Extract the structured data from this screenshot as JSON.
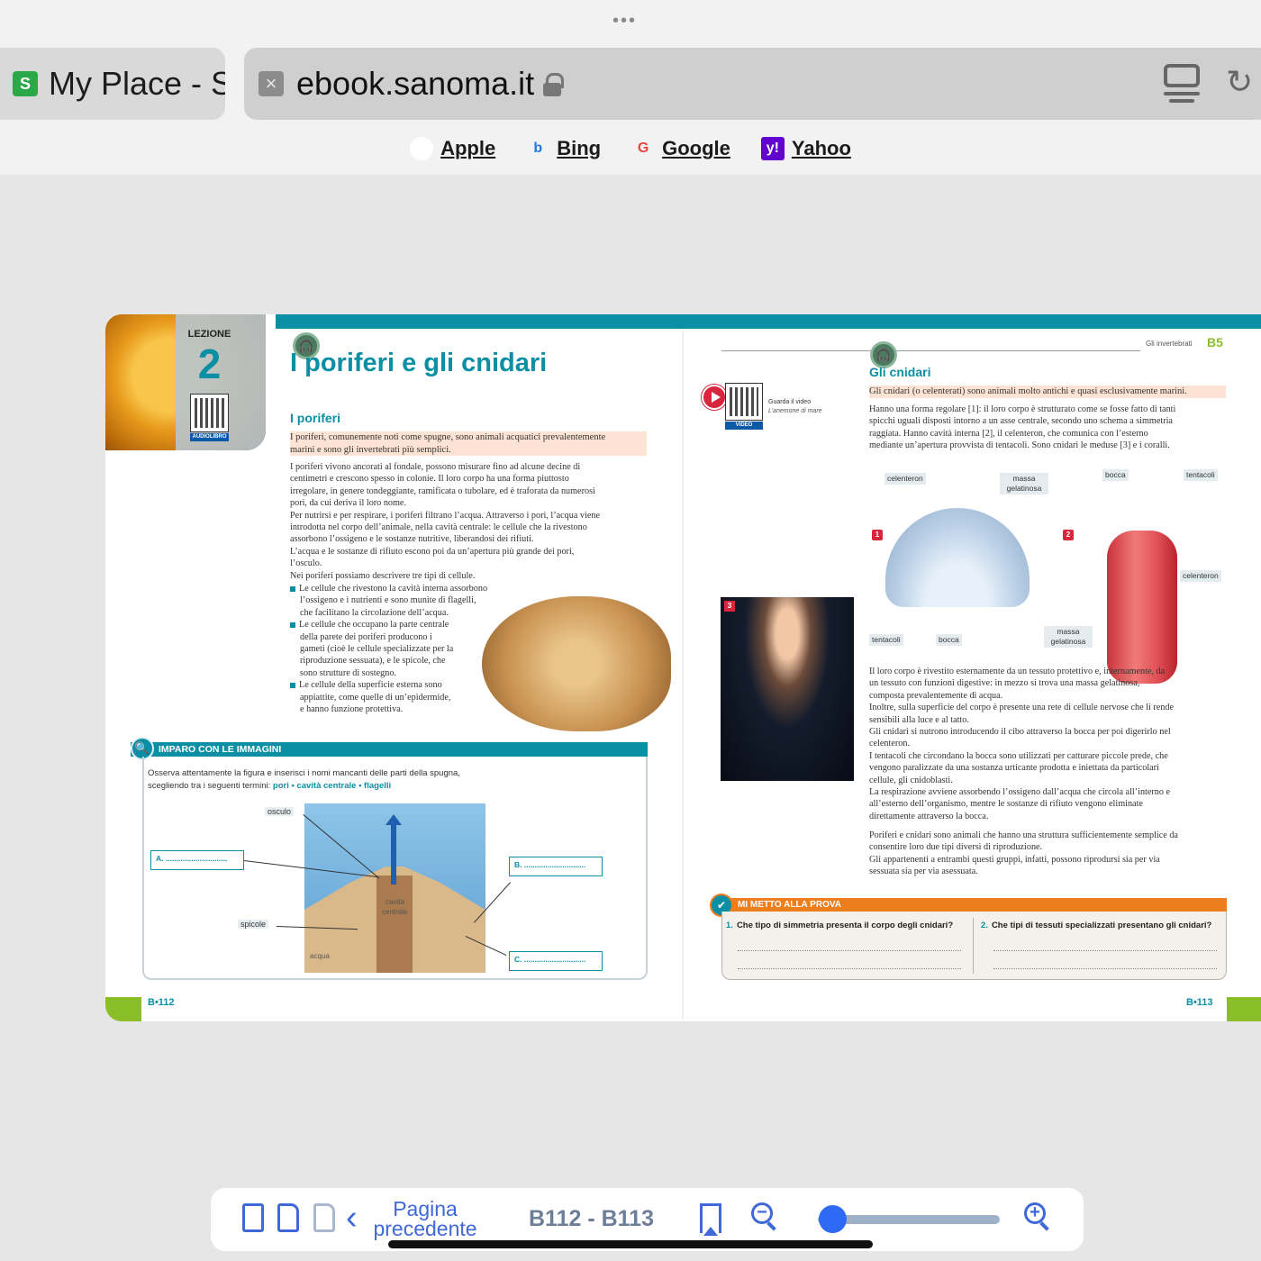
{
  "browser": {
    "more_dots": "•••",
    "tab": {
      "favicon": "S",
      "title": "My Place - S"
    },
    "url": "ebook.sanoma.it",
    "reader_icon": "reader-mode-icon",
    "reload_icon": "reload-icon",
    "favorites": [
      {
        "label": "Apple",
        "icon": "apple-icon"
      },
      {
        "label": "Bing",
        "icon": "bing-icon"
      },
      {
        "label": "Google",
        "icon": "google-icon"
      },
      {
        "label": "Yahoo",
        "icon": "yahoo-icon"
      }
    ]
  },
  "left_page": {
    "lesson_label": "LEZIONE",
    "lesson_number": "2",
    "audiobook_tag": "AUDIOLIBRO",
    "title": "I poriferi e gli cnidari",
    "section_heading": "I poriferi",
    "intro_highlight_1": "I poriferi, comunemente noti come spugne, sono animali acquatici prevalentemente",
    "intro_highlight_2": "marini e sono gli invertebrati più semplici.",
    "body_lines": [
      "I poriferi vivono ancorati al fondale, possono misurare fino ad alcune decine di",
      "centimetri e crescono spesso in colonie. Il loro corpo ha una forma piuttosto",
      "irregolare, in genere tondeggiante, ramificata o tubolare, ed è traforata da numerosi",
      "pori, da cui deriva il loro nome.",
      "Per nutrirsi e per respirare, i poriferi filtrano l’acqua. Attraverso i pori, l’acqua viene",
      "introdotta nel corpo dell’animale, nella cavità centrale: le cellule che la rivestono",
      "assorbono l’ossigeno e le sostanze nutritive, liberandosi dei rifiuti.",
      "L’acqua e le sostanze di rifiuto escono poi da un’apertura più grande dei pori,",
      "l’osculo.",
      "Nei poriferi possiamo descrivere tre tipi di cellule."
    ],
    "bullet_1": [
      "Le cellule che rivestono la cavità interna assorbono",
      "l’ossigeno e i nutrienti e sono munite di flagelli,",
      "che facilitano la circolazione dell’acqua."
    ],
    "bullet_2": [
      "Le cellule che occupano la parte centrale",
      "della parete dei poriferi producono i",
      "gameti (cioè le cellule specializzate per la",
      "riproduzione sessuata), e le spicole, che",
      "sono strutture di sostegno."
    ],
    "bullet_3": [
      "Le cellule della superficie esterna sono",
      "appiattite, come quelle di un’epidermide,",
      "e hanno funzione protettiva."
    ],
    "activity": {
      "title": "IMPARO CON LE IMMAGINI",
      "instruction_1": "Osserva attentamente la figura e inserisci i nomi mancanti delle parti della spugna,",
      "instruction_2": "scegliendo tra i seguenti termini:",
      "terms": "pori • cavità centrale • flagelli",
      "labels": {
        "osculo": "osculo",
        "spicole": "spicole",
        "acqua": "acqua",
        "cavity_1": "cavità",
        "cavity_2": "centrale"
      },
      "answers": {
        "a": "A. .............................",
        "b": "B. .............................",
        "c": "C. ............................."
      }
    },
    "page_number": "B•112"
  },
  "right_page": {
    "running_head": "Gli invertebrati",
    "running_code": "B5",
    "video_caption_1": "Guarda il video",
    "video_caption_2": "L’anemone di mare",
    "video_tag": "VIDEO",
    "section_heading": "Gli cnidari",
    "highlight": "Gli cnidari (o celenterati) sono animali molto antichi e quasi esclusivamente marini.",
    "intro_lines": [
      "Hanno una forma regolare [1]: il loro corpo è strutturato come se fosse fatto di tanti",
      "spicchi uguali disposti intorno a un asse centrale, secondo uno schema a simmetria",
      "raggiata. Hanno cavità interna [2], il celenteron, che comunica con l’esterno",
      "mediante un’apertura provvista di tentacoli. Sono cnidari le meduse [3] e i coralli."
    ],
    "figure_labels": {
      "celenteron_top": "celenteron",
      "massa_top": "massa gelatinosa",
      "bocca_top": "bocca",
      "tentacoli_top": "tentacoli",
      "celenteron_right": "celenteron",
      "tentacoli_bottom": "tentacoli",
      "bocca_bottom": "bocca",
      "massa_bottom": "massa gelatinosa",
      "fig1": "1",
      "fig2": "2",
      "fig3": "3"
    },
    "body_lines_1": [
      "Il loro corpo è rivestito esternamente da un tessuto protettivo e, internamente, da",
      "un tessuto con funzioni digestive: in mezzo si trova una massa gelatinosa,",
      "composta prevalentemente di acqua.",
      "Inoltre, sulla superficie del corpo è presente una rete di cellule nervose che li rende",
      "sensibili alla luce e al tatto.",
      "Gli cnidari si nutrono introducendo il cibo attraverso la bocca per poi digerirlo nel",
      "celenteron.",
      "I tentacoli che circondano la bocca sono utilizzati per catturare piccole prede, che",
      "vengono paralizzate da una sostanza urticante prodotta e iniettata da particolari",
      "cellule, gli cnidoblasti.",
      "La respirazione avviene assorbendo l’ossigeno dall’acqua che circola all’interno e",
      "all’esterno dell’organismo, mentre le sostanze di rifiuto vengono eliminate",
      "direttamente attraverso la bocca."
    ],
    "body_lines_2": [
      "Poriferi e cnidari sono animali che hanno una struttura sufficientemente semplice da",
      "consentire loro due tipi diversi di riproduzione.",
      "Gli appartenenti a entrambi questi gruppi, infatti, possono riprodursi sia per via",
      "sessuata sia per via asessuata."
    ],
    "test": {
      "title": "MI METTO ALLA PROVA",
      "q1_num": "1.",
      "q1": "Che tipo di simmetria presenta il corpo degli cnidari?",
      "q2_num": "2.",
      "q2": "Che tipi di tessuti specializzati presentano gli cnidari?"
    },
    "page_number": "B•113"
  },
  "toolbar": {
    "prev_label_1": "Pagina",
    "prev_label_2": "precedente",
    "page_range": "B112 - B113",
    "zoom_out": "−",
    "zoom_in": "+",
    "zoom_level": 0.08
  }
}
